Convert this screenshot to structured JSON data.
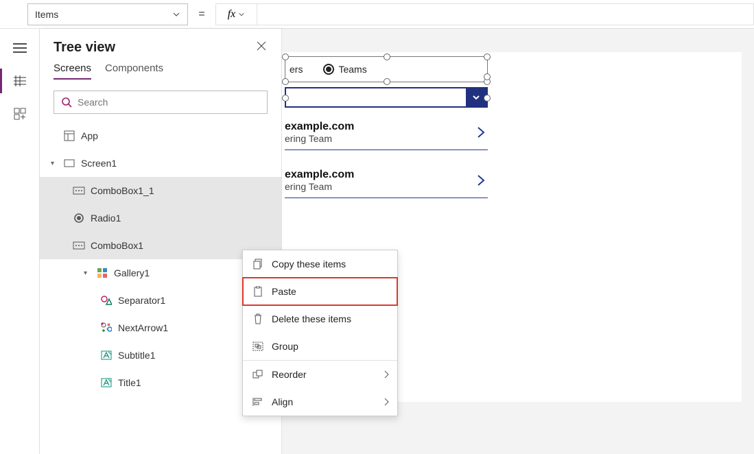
{
  "formula_bar": {
    "property": "Items",
    "equals": "=",
    "fx": "fx"
  },
  "tree": {
    "title": "Tree view",
    "tabs": {
      "screens": "Screens",
      "components": "Components"
    },
    "search_placeholder": "Search",
    "items": {
      "app": "App",
      "screen1": "Screen1",
      "combobox1_1": "ComboBox1_1",
      "radio1": "Radio1",
      "combobox1": "ComboBox1",
      "gallery1": "Gallery1",
      "separator1": "Separator1",
      "nextarrow1": "NextArrow1",
      "subtitle1": "Subtitle1",
      "title1": "Title1"
    }
  },
  "canvas": {
    "radio": {
      "opt1": "ers",
      "opt2": "Teams"
    },
    "rows": [
      {
        "title": "example.com",
        "subtitle": "ering Team"
      },
      {
        "title": "example.com",
        "subtitle": "ering Team"
      }
    ]
  },
  "context_menu": {
    "copy": "Copy these items",
    "paste": "Paste",
    "delete": "Delete these items",
    "group": "Group",
    "reorder": "Reorder",
    "align": "Align"
  }
}
